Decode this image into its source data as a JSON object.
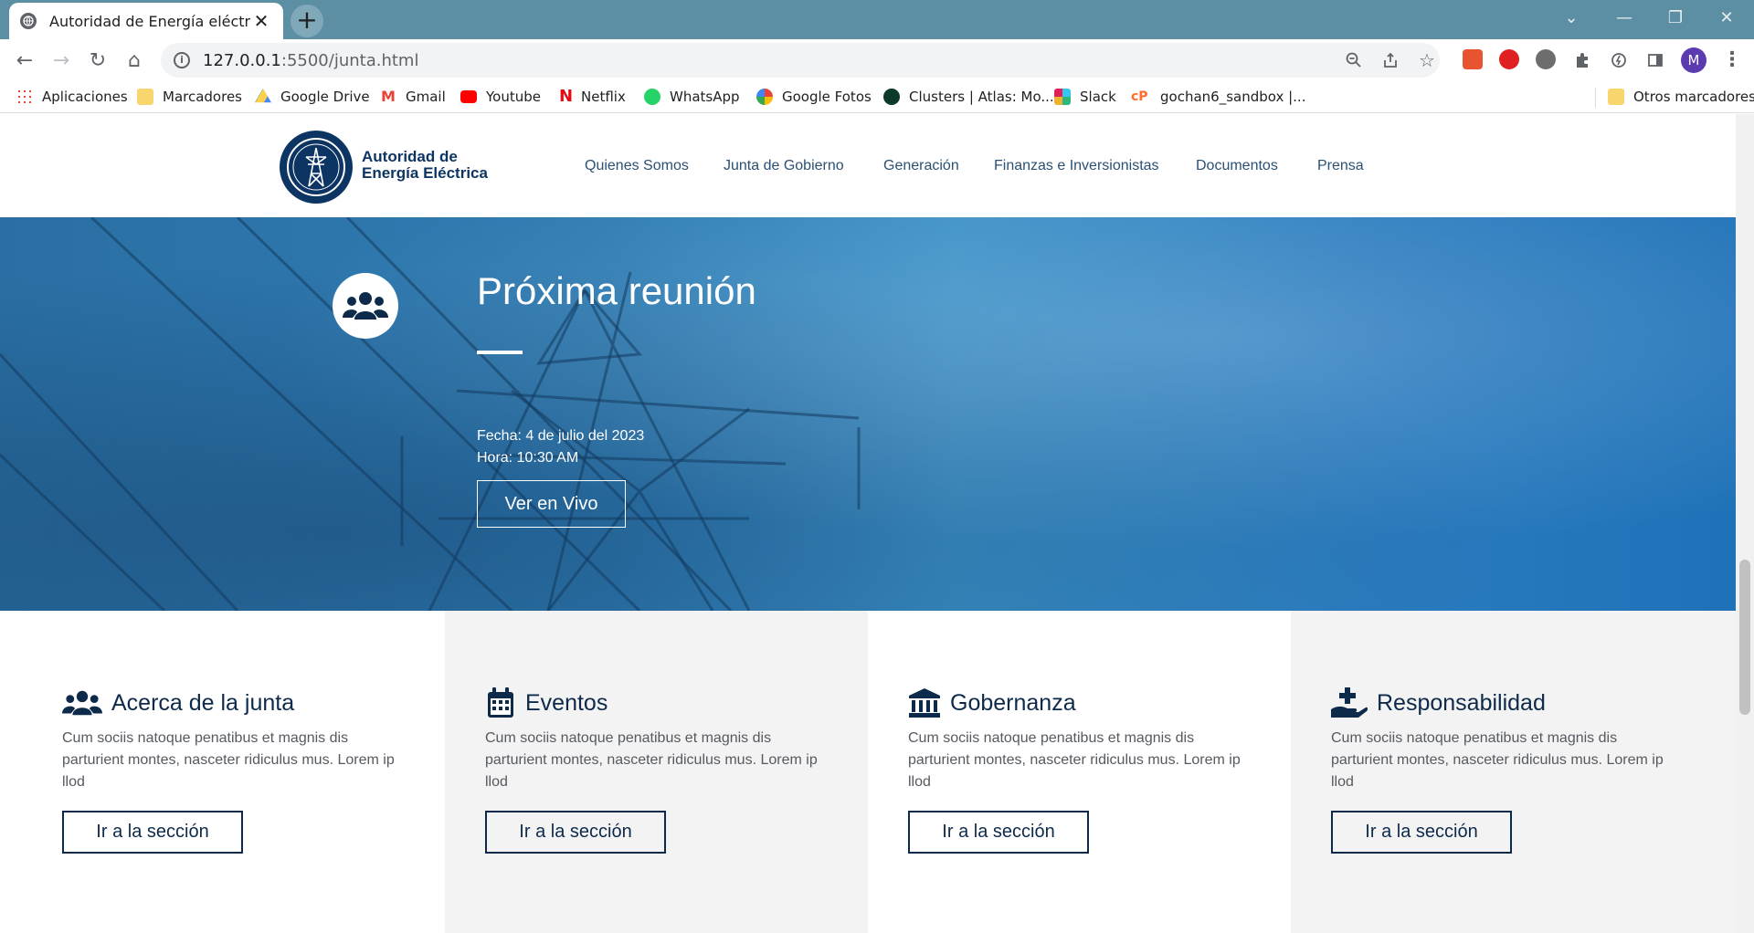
{
  "browser": {
    "tab_title": "Autoridad de Energía eléctrica",
    "url_host": "127.0.0.1",
    "url_rest": ":5500/junta.html",
    "avatar_letter": "M",
    "bookmarks": [
      {
        "label": "Aplicaciones",
        "icon": "apps-grid-icon",
        "color": "#ea4335"
      },
      {
        "label": "Marcadores",
        "icon": "folder-icon",
        "color": "#f9d56e"
      },
      {
        "label": "Google Drive",
        "icon": "google-drive-icon",
        "color": "#1fa463"
      },
      {
        "label": "Gmail",
        "icon": "gmail-icon",
        "color": "#ea4335"
      },
      {
        "label": "Youtube",
        "icon": "youtube-icon",
        "color": "#ff0000"
      },
      {
        "label": "Netflix",
        "icon": "netflix-icon",
        "color": "#e50914"
      },
      {
        "label": "WhatsApp",
        "icon": "whatsapp-icon",
        "color": "#25d366"
      },
      {
        "label": "Google Fotos",
        "icon": "google-photos-icon",
        "color": "#fbbc05"
      },
      {
        "label": "Clusters | Atlas: Mo...",
        "icon": "mongodb-leaf-icon",
        "color": "#13aa52"
      },
      {
        "label": "Slack",
        "icon": "slack-icon",
        "color": "#e01e5a"
      },
      {
        "label": "gochan6_sandbox |...",
        "icon": "cpanel-icon",
        "color": "#ff6c2c"
      }
    ],
    "other_bookmarks": "Otros marcadores"
  },
  "site": {
    "logo_line1": "Autoridad de",
    "logo_line2": "Energía Eléctrica",
    "nav": [
      "Quienes Somos",
      "Junta de Gobierno",
      "Generación",
      "Finanzas e Inversionistas",
      "Documentos",
      "Prensa"
    ]
  },
  "hero": {
    "title": "Próxima reunión",
    "date": "Fecha: 4 de julio del 2023",
    "time": "Hora: 10:30 AM",
    "button": "Ver en Vivo",
    "icon": "users-group-icon"
  },
  "cards": [
    {
      "title": "Acerca de la junta",
      "icon": "users-group-icon",
      "text": "Cum sociis natoque penatibus et magnis dis parturient montes, nasceter ridiculus mus. Lorem ip llod",
      "button": "Ir a la sección",
      "bg": "#ffffff"
    },
    {
      "title": "Eventos",
      "icon": "calendar-icon",
      "text": "Cum sociis natoque penatibus et magnis dis parturient montes, nasceter ridiculus mus. Lorem ip llod",
      "button": "Ir a la sección",
      "bg": "#f3f3f3"
    },
    {
      "title": "Gobernanza",
      "icon": "institution-icon",
      "text": "Cum sociis natoque penatibus et magnis dis parturient montes, nasceter ridiculus mus. Lorem ip llod",
      "button": "Ir a la sección",
      "bg": "#ffffff"
    },
    {
      "title": "Responsabilidad",
      "icon": "hand-holding-medical-icon",
      "text": "Cum sociis natoque penatibus et magnis dis parturient montes, nasceter ridiculus mus. Lorem ip llod",
      "button": "Ir a la sección",
      "bg": "#f3f3f3"
    }
  ],
  "colors": {
    "tabbar": "#5c8fa3",
    "brand_navy": "#0d3563",
    "hero_blue": "#2f7cb3"
  }
}
